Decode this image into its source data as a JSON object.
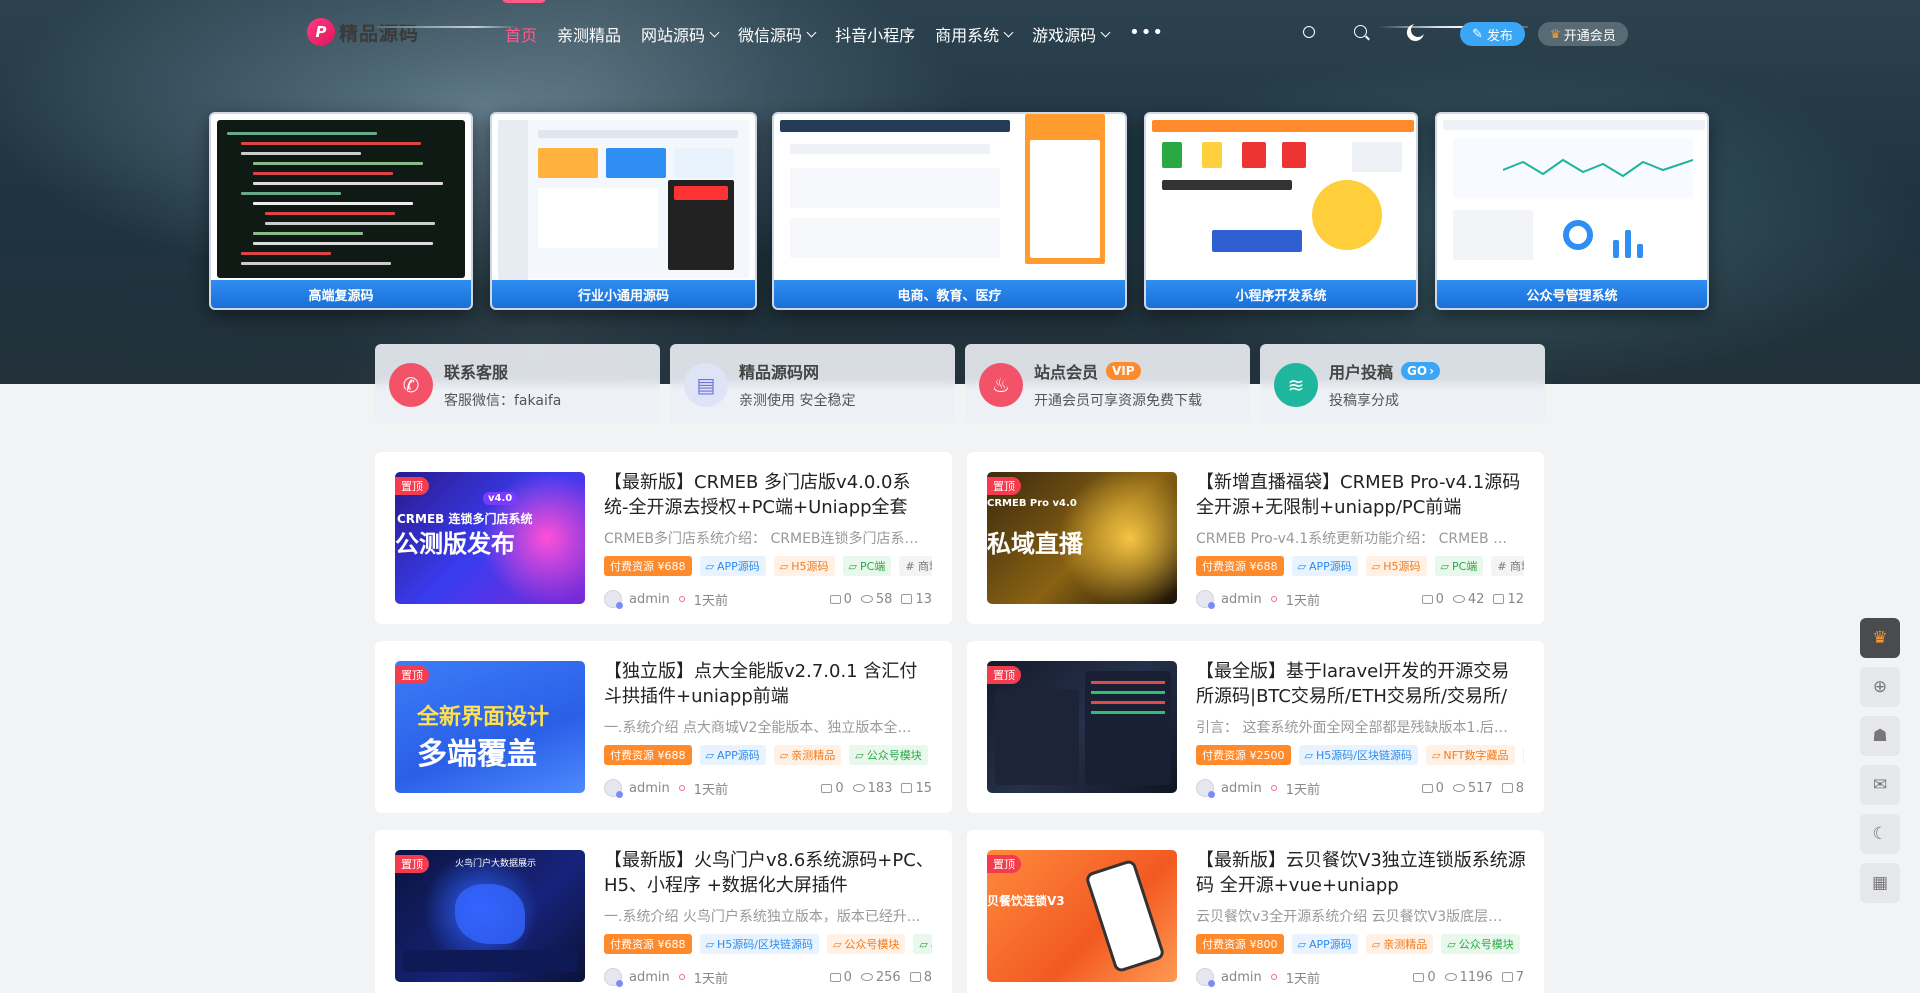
{
  "site": {
    "logo_text": "精品源码",
    "logo_mark": "P"
  },
  "nav": {
    "items": [
      {
        "label": "首页",
        "active": true,
        "dropdown": false
      },
      {
        "label": "亲测精品",
        "dropdown": false
      },
      {
        "label": "网站源码",
        "dropdown": true
      },
      {
        "label": "微信源码",
        "dropdown": true
      },
      {
        "label": "抖音小程序",
        "dropdown": false
      },
      {
        "label": "商用系统",
        "dropdown": true
      },
      {
        "label": "游戏源码",
        "dropdown": true
      }
    ],
    "more": "•••",
    "publish_label": "发布",
    "publish_icon": "✎",
    "vip_label": "开通会员",
    "vip_icon": "♛"
  },
  "showcase": [
    {
      "caption": "高端复源码"
    },
    {
      "caption": "行业小通用源码"
    },
    {
      "caption": "电商、教育、医疗"
    },
    {
      "caption": "小程序开发系统"
    },
    {
      "caption": "公众号管理系统"
    }
  ],
  "features": [
    {
      "title": "联系客服",
      "subtitle": "客服微信：fakaifa",
      "icon": "wechat-icon",
      "glyph": "✆",
      "color": "#f35369",
      "badge": ""
    },
    {
      "title": "精品源码网",
      "subtitle": "亲测使用 安全稳定",
      "icon": "chart-icon",
      "glyph": "▤",
      "color": "#d8dcf4",
      "badge": ""
    },
    {
      "title": "站点会员",
      "subtitle": "开通会员可享资源免费下载",
      "icon": "fire-icon",
      "glyph": "♨",
      "color": "#f35369",
      "badge": "VIP"
    },
    {
      "title": "用户投稿",
      "subtitle": "投稿享分成",
      "icon": "edit-icon",
      "glyph": "≋",
      "color": "#1eb69d",
      "badge": "GO"
    }
  ],
  "posts": [
    {
      "pin": "置顶",
      "title": "【最新版】CRMEB 多门店版v4.0.0系统-全开源去授权+PC端+Uniapp全套",
      "desc": "CRMEB多门店系统介绍：  CRMEB连锁多门店系统...",
      "tags": [
        {
          "text": "付费资源 ¥688",
          "kind": "pay"
        },
        {
          "text": "APP源码",
          "kind": "blue"
        },
        {
          "text": "H5源码",
          "kind": "orange"
        },
        {
          "text": "PC端",
          "kind": "green"
        },
        {
          "text": "# 商城",
          "kind": "gray"
        }
      ],
      "author": "admin",
      "time": "1天前",
      "comments": "0",
      "views": "58",
      "likes": "13",
      "thumb_text": "公测版发布",
      "thumb_sub": "CRMEB 连锁多门店系统",
      "thumb_badge": "v4.0"
    },
    {
      "pin": "置顶",
      "title": "【新增直播福袋】CRMEB Pro-v4.1源码全开源+无限制+uniapp/PC前端",
      "desc": "CRMEB Pro-v4.1系统更新功能介绍：  CRMEB Pro...",
      "tags": [
        {
          "text": "付费资源 ¥688",
          "kind": "pay"
        },
        {
          "text": "APP源码",
          "kind": "blue"
        },
        {
          "text": "H5源码",
          "kind": "orange"
        },
        {
          "text": "PC端",
          "kind": "green"
        },
        {
          "text": "# 商城",
          "kind": "gray"
        }
      ],
      "author": "admin",
      "time": "1天前",
      "comments": "0",
      "views": "42",
      "likes": "12",
      "thumb_text": "私域直播",
      "thumb_sub": "CRMEB Pro v4.0",
      "thumb_badge": ""
    },
    {
      "pin": "置顶",
      "title": "【独立版】点大全能版v2.7.0.1 含汇付斗拱插件+uniapp前端",
      "desc": "一.系统介绍 点大商城V2全能版本、独立版本全开...",
      "tags": [
        {
          "text": "付费资源 ¥688",
          "kind": "pay"
        },
        {
          "text": "APP源码",
          "kind": "blue"
        },
        {
          "text": "亲测精品",
          "kind": "orange"
        },
        {
          "text": "公众号模块",
          "kind": "green"
        }
      ],
      "author": "admin",
      "time": "1天前",
      "comments": "0",
      "views": "183",
      "likes": "15",
      "thumb_text": "全新界面设计",
      "thumb_sub": "多端覆盖",
      "thumb_badge": ""
    },
    {
      "pin": "置顶",
      "title": "【最全版】基于laravel开发的开源交易所源码|BTC交易所/ETH交易所/交易所/交...",
      "desc": "引言：  这套系统外面全网全部都是残缺版本1.后端...",
      "tags": [
        {
          "text": "付费资源 ¥2500",
          "kind": "pay"
        },
        {
          "text": "H5源码/区块链源码",
          "kind": "blue"
        },
        {
          "text": "NFT数字藏品",
          "kind": "orange"
        },
        {
          "text": "D",
          "kind": "green"
        }
      ],
      "author": "admin",
      "time": "1天前",
      "comments": "0",
      "views": "517",
      "likes": "8",
      "thumb_text": "",
      "thumb_sub": "",
      "thumb_badge": ""
    },
    {
      "pin": "置顶",
      "title": "【最新版】火鸟门户v8.6系统源码+PC、H5、小程序 +数据化大屏插件",
      "desc": "一.系统介绍 火鸟门户系统独立版本，版本已经升...",
      "tags": [
        {
          "text": "付费资源 ¥688",
          "kind": "pay"
        },
        {
          "text": "H5源码/区块链源码",
          "kind": "blue"
        },
        {
          "text": "公众号模块",
          "kind": "orange"
        },
        {
          "text": "小",
          "kind": "green"
        }
      ],
      "author": "admin",
      "time": "1天前",
      "comments": "0",
      "views": "256",
      "likes": "8",
      "thumb_text": "",
      "thumb_sub": "火鸟门户大数据展示",
      "thumb_badge": ""
    },
    {
      "pin": "置顶",
      "title": "【最新版】云贝餐饮V3独立连锁版系统源码 全开源+vue+uniapp",
      "desc": "云贝餐饮v3全开源系统介绍 云贝餐饮V3版底层开...",
      "tags": [
        {
          "text": "付费资源 ¥800",
          "kind": "pay"
        },
        {
          "text": "APP源码",
          "kind": "blue"
        },
        {
          "text": "亲测精品",
          "kind": "orange"
        },
        {
          "text": "公众号模块",
          "kind": "green"
        }
      ],
      "author": "admin",
      "time": "1天前",
      "comments": "0",
      "views": "1196",
      "likes": "7",
      "thumb_text": "",
      "thumb_sub": "贝餐饮连锁V3",
      "thumb_badge": ""
    }
  ],
  "side_tools": [
    {
      "icon": "crown-icon",
      "glyph": "♛"
    },
    {
      "icon": "plus-icon",
      "glyph": "⊕"
    },
    {
      "icon": "qq-icon",
      "glyph": "☗"
    },
    {
      "icon": "wechat-icon",
      "glyph": "✉"
    },
    {
      "icon": "moon-icon",
      "glyph": "☾"
    },
    {
      "icon": "qrcode-icon",
      "glyph": "▦"
    }
  ]
}
